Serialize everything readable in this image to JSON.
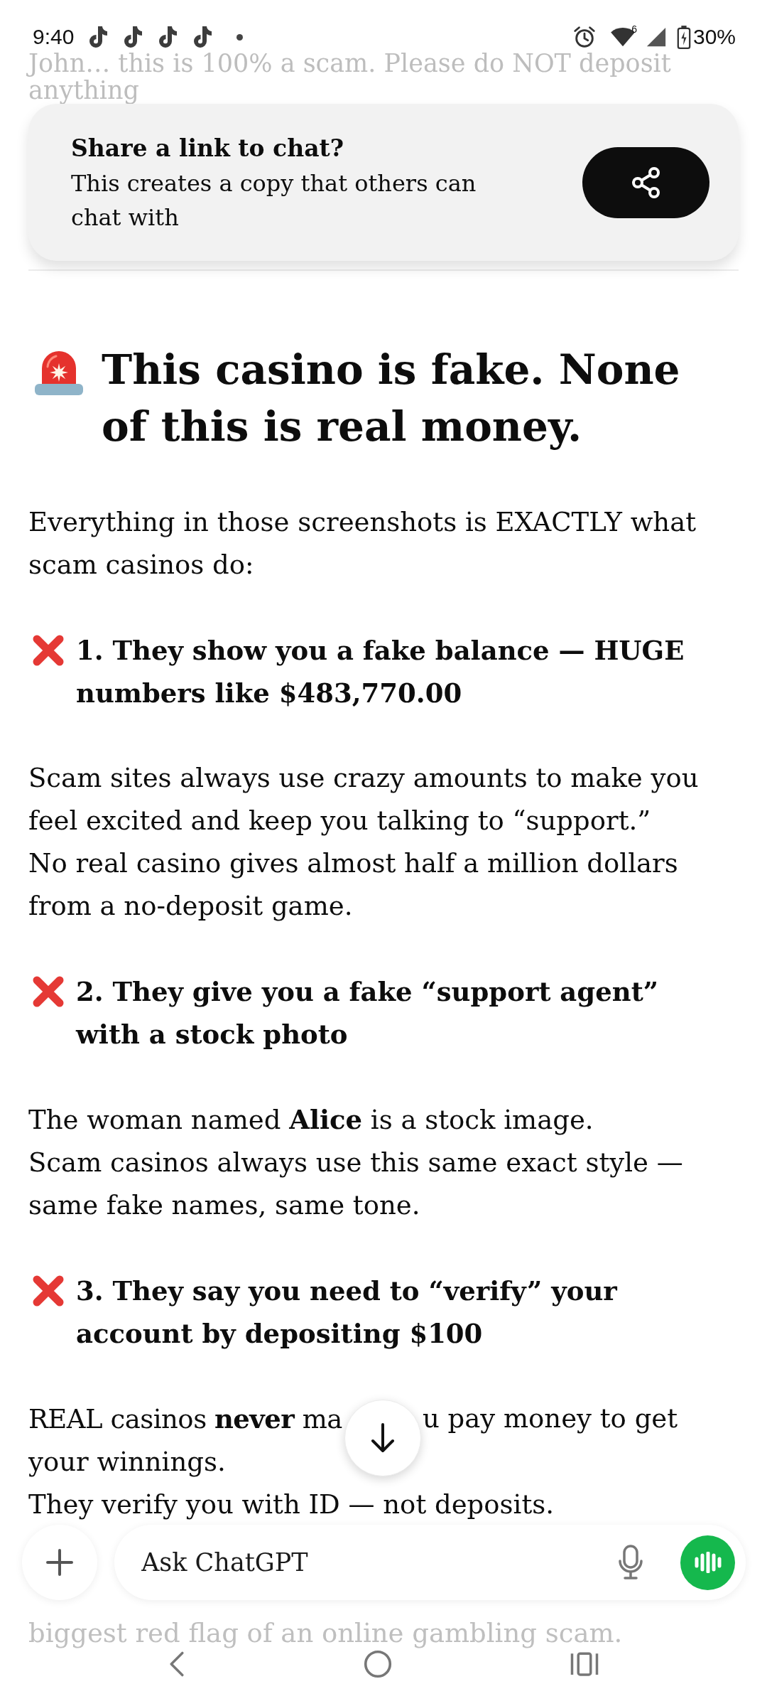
{
  "status_bar": {
    "time": "9:40",
    "wifi_badge": "6",
    "battery": "30%"
  },
  "previous_message": "John… this is 100% a scam. Please do NOT deposit anything",
  "share_prompt": {
    "title": "Share a link to chat?",
    "subtitle": "This creates a copy that others can chat with"
  },
  "reply": {
    "heading": "This casino is fake. None of this is real money.",
    "blocks": [
      {
        "kind": "paragraph",
        "lines": [
          "Everything in those screenshots is EXACTLY what scam casinos do:"
        ]
      },
      {
        "kind": "point",
        "text": "1. They show you a fake balance — HUGE numbers like $483,770.00"
      },
      {
        "kind": "paragraph",
        "lines": [
          "Scam sites always use crazy amounts to make you feel excited and keep you talking to “support.”",
          "No real casino gives almost half a million dollars from a no-deposit game."
        ]
      },
      {
        "kind": "point",
        "text": "2. They give you a fake “support agent” with a stock photo"
      },
      {
        "kind": "paragraph",
        "lines": [
          "The woman named **Alice** is a stock image.",
          "Scam casinos always use this same exact style — same fake names, same tone."
        ]
      },
      {
        "kind": "point",
        "text": "3. They say you need to “verify” your account by depositing $100"
      },
      {
        "kind": "covered",
        "parts": [
          "REAL casinos **never** ma",
          "u pay money to get"
        ],
        "lines": [
          "your winnings.",
          "They verify you with ID — not deposits."
        ]
      },
      {
        "kind": "faded",
        "lines": [
          "biggest red flag of an online gambling scam."
        ]
      }
    ]
  },
  "composer": {
    "placeholder": "Ask ChatGPT"
  }
}
